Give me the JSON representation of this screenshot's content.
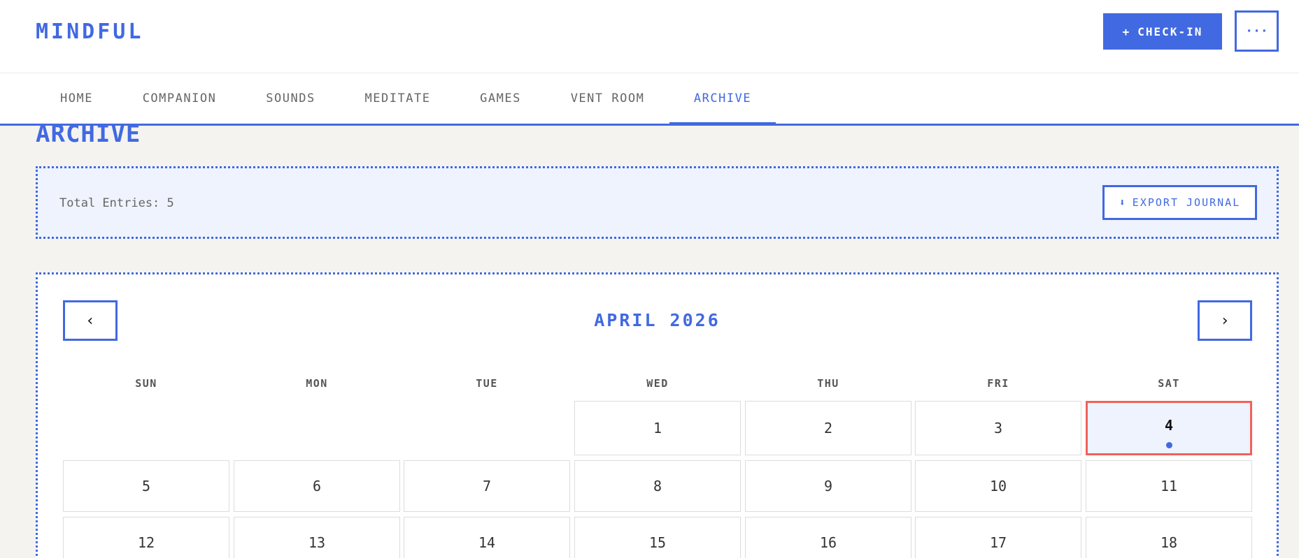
{
  "brand": "MINDFUL",
  "header": {
    "checkin_icon": "+",
    "checkin_label": "CHECK-IN",
    "more_icon": "···"
  },
  "nav": {
    "tabs": [
      {
        "label": "HOME",
        "active": false
      },
      {
        "label": "COMPANION",
        "active": false
      },
      {
        "label": "SOUNDS",
        "active": false
      },
      {
        "label": "MEDITATE",
        "active": false
      },
      {
        "label": "GAMES",
        "active": false
      },
      {
        "label": "VENT ROOM",
        "active": false
      },
      {
        "label": "ARCHIVE",
        "active": true
      }
    ]
  },
  "page_title": "ARCHIVE",
  "summary": {
    "total_text": "Total Entries: 5",
    "export_icon": "⬇",
    "export_label": "EXPORT JOURNAL"
  },
  "calendar": {
    "prev_icon": "‹",
    "next_icon": "›",
    "month": "APRIL 2026",
    "weekdays": [
      "SUN",
      "MON",
      "TUE",
      "WED",
      "THU",
      "FRI",
      "SAT"
    ],
    "week1": [
      "1",
      "2",
      "3",
      "4"
    ],
    "week2": [
      "5",
      "6",
      "7",
      "8",
      "9",
      "10",
      "11"
    ],
    "week3": [
      "12",
      "13",
      "14",
      "15",
      "16",
      "17",
      "18"
    ],
    "today": "4",
    "entry_days": [
      "4"
    ]
  },
  "colors": {
    "accent": "#4169e1",
    "today_border": "#f0625a",
    "panel_bg": "#eef3fd"
  }
}
